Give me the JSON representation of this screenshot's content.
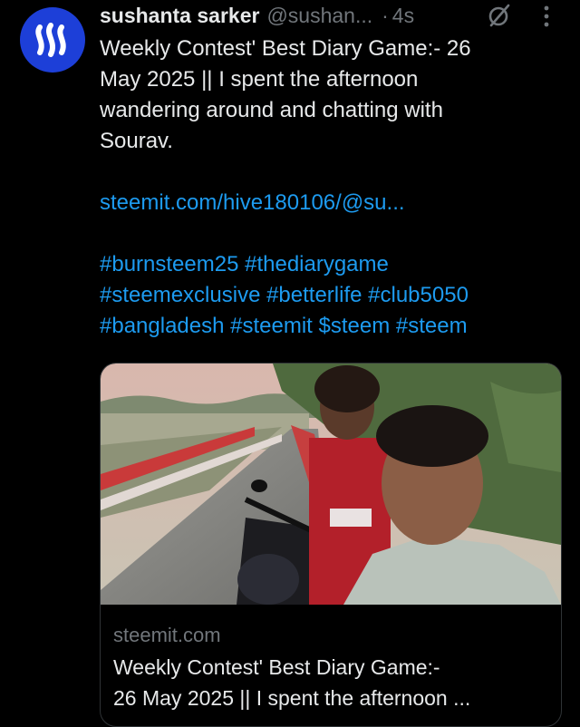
{
  "tweet": {
    "author_name": "sushanta sarker",
    "author_handle": "@sushan...",
    "separator": "·",
    "timestamp": "4s",
    "avatar_icon": "steem-logo-icon",
    "grok_icon": "grok-icon",
    "more_icon": "more-options-icon",
    "text_line1": "Weekly Contest' Best Diary Game:- 26",
    "text_line2": "May 2025 || I spent the afternoon",
    "text_line3": "wandering around and chatting with",
    "text_line4": "Sourav.",
    "link": "steemit.com/hive180106/@su...",
    "hashtag_line1": "#burnsteem25 #thediarygame",
    "hashtag_line2": "#steemexclusive #betterlife #club5050",
    "hashtag_line3": "#bangladesh #steemit  $steem #steem"
  },
  "card": {
    "domain": "steemit.com",
    "title_line1": "Weekly Contest' Best Diary Game:-",
    "title_line2": "26 May 2025 || I spent the afternoon ..."
  },
  "colors": {
    "background": "#000000",
    "text": "#e7e9ea",
    "muted": "#71767b",
    "link": "#1d9bf0",
    "avatar": "#1d3fd8"
  }
}
